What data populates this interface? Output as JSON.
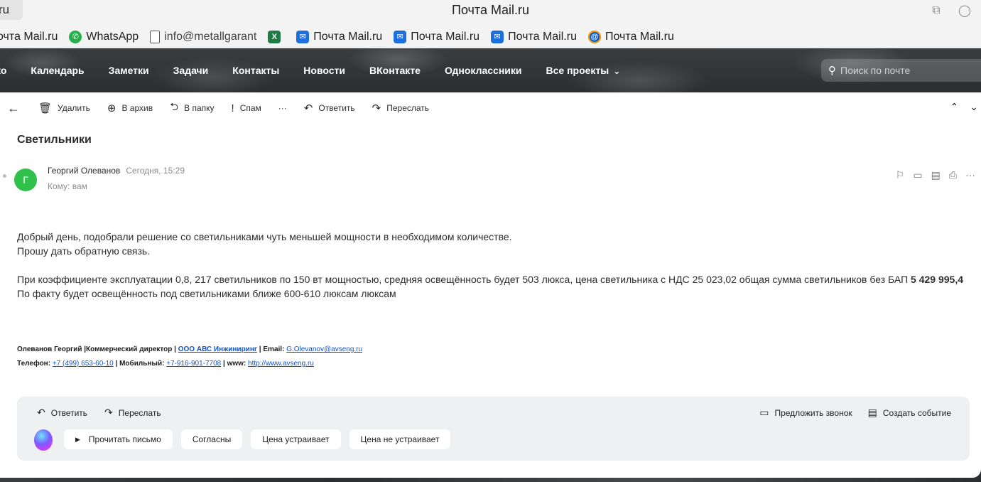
{
  "browser": {
    "url_fragment": "ru",
    "window_title": "Почта Mail.ru",
    "bookmarks": [
      {
        "label": "очта Mail.ru",
        "icon": "none"
      },
      {
        "label": "WhatsApp",
        "icon": "whatsapp-icon"
      },
      {
        "label": "info@metallgarant",
        "icon": "document-icon"
      },
      {
        "label": "",
        "icon": "excel-icon"
      },
      {
        "label": "Почта Mail.ru",
        "icon": "mail-icon"
      },
      {
        "label": "Почта Mail.ru",
        "icon": "mail-icon"
      },
      {
        "label": "Почта Mail.ru",
        "icon": "mail-icon"
      },
      {
        "label": "Почта Mail.ru",
        "icon": "at-icon"
      }
    ]
  },
  "nav": {
    "items": [
      "ко",
      "Календарь",
      "Заметки",
      "Задачи",
      "Контакты",
      "Новости",
      "ВКонтакте",
      "Одноклассники",
      "Все проекты"
    ],
    "search_placeholder": "Поиск по почте"
  },
  "toolbar": {
    "delete": "Удалить",
    "archive": "В архив",
    "to_folder": "В папку",
    "spam": "Спам",
    "more": "···",
    "reply": "Ответить",
    "forward": "Переслать"
  },
  "message": {
    "subject": "Светильники",
    "avatar_letter": "Г",
    "sender": "Георгий Олеванов",
    "date": "Сегодня, 15:29",
    "to": "Кому: вам",
    "body_line1": "Добрый день, подобрали решение со светильниками чуть меньшей мощности в необходимом количестве.",
    "body_line2": "Прошу дать обратную связь.",
    "body_line3": "При коэффициенте эксплуатации 0,8,  217 светильников по 150 вт мощностью, средняя освещённость будет 503 люкса, цена светильника с НДС 25 023,02 общая сумма светильников без БАП ",
    "body_line3_bold": "5 429 995,4",
    "body_line4": "По факту будет освещённость под светильниками ближе 600-610 люксам люксам"
  },
  "signature": {
    "name": "Олеванов Георгий |Коммерческий директор | ",
    "company": "ООО АВС Инжиниринг",
    "email_label": " | Email: ",
    "email": "G.Olevanov@avseng.ru",
    "phone_label": "Телефон: ",
    "phone": "+7 (499) 653-60-10",
    "mobile_label": " | Мобильный: ",
    "mobile": "+7-916-901-7708",
    "www_label": " | www: ",
    "www": "http://www.avseng.ru"
  },
  "quick_reply": {
    "reply": "Ответить",
    "forward": "Переслать",
    "propose_call": "Предложить звонок",
    "create_event": "Создать событие",
    "chips": [
      "Прочитать письмо",
      "Согласны",
      "Цена устраивает",
      "Цена не устраивает"
    ]
  }
}
